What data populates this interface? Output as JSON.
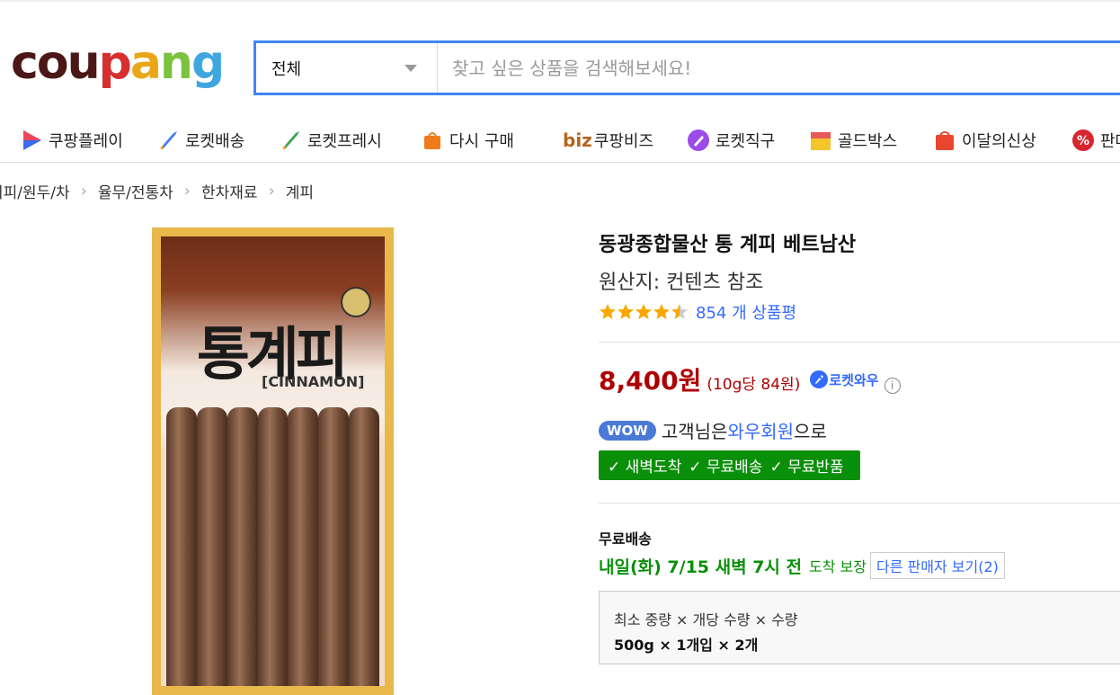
{
  "header": {
    "logo_letters": [
      "c",
      "o",
      "u",
      "p",
      "a",
      "n",
      "g"
    ],
    "logo_colors": [
      "#4b1717",
      "#4b1717",
      "#4b1717",
      "#d72e2e",
      "#e9a617",
      "#7cc241",
      "#3fa6e0"
    ],
    "search": {
      "category": "전체",
      "placeholder": "찾고 싶은 상품을 검색해보세요!"
    }
  },
  "nav": [
    {
      "label": "쿠팡플레이",
      "icon": "play-icon"
    },
    {
      "label": "로켓배송",
      "icon": "rocket-icon"
    },
    {
      "label": "로켓프레시",
      "icon": "rocket-fresh-icon"
    },
    {
      "label": "다시 구매",
      "icon": "rebuy-bag-icon"
    },
    {
      "label": "쿠팡비즈",
      "prefix": "biz",
      "icon": "biz-icon"
    },
    {
      "label": "로켓직구",
      "icon": "rocket-global-icon"
    },
    {
      "label": "골드박스",
      "icon": "goldbox-icon"
    },
    {
      "label": "이달의신상",
      "icon": "new-bag-icon"
    },
    {
      "label": "판매",
      "icon": "percent-icon"
    }
  ],
  "breadcrumb": [
    "커피/원두/차",
    "율무/전통차",
    "한차재료",
    "계피"
  ],
  "product_image": {
    "title": "통계피",
    "subtitle": "[CINNAMON]"
  },
  "product": {
    "name": "동광종합물산 통 계피 베트남산",
    "origin": "원산지: 컨텐츠 참조",
    "rating": 4.5,
    "review_count": "854 개 상품평",
    "price": "8,400원",
    "unit_price": "(10g당 84원)",
    "rocket_badge": "로켓와우",
    "wow_badge": "WOW",
    "wow_text_pre": "고객님은 ",
    "wow_text_hl": "와우회원",
    "wow_text_post": "으로",
    "benefits": [
      "새벽도착",
      "무료배송",
      "무료반품"
    ],
    "shipping_title": "무료배송",
    "shipping_date": "내일(화) 7/15 새벽 7시 전",
    "shipping_note": "도착 보장",
    "other_sellers": "다른 판매자 보기(2)",
    "option_label": "최소 중량 × 개당 수량 × 수량",
    "option_value": "500g × 1개입 × 2개"
  }
}
